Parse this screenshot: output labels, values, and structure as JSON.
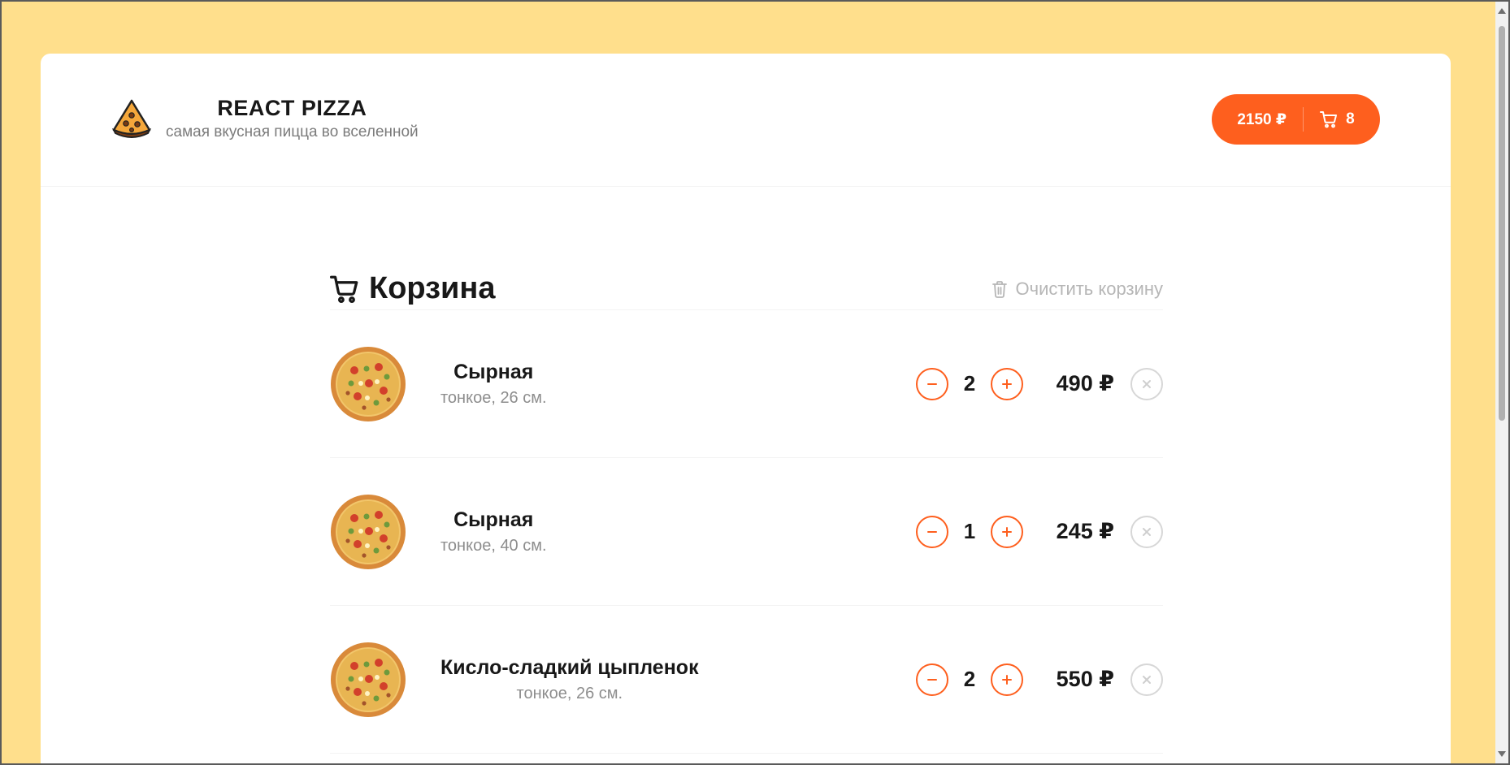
{
  "header": {
    "title": "REACT PIZZA",
    "subtitle": "самая вкусная пицца во вселенной",
    "logo_icon": "pizza-slice-icon"
  },
  "cart_button": {
    "total": "2150 ₽",
    "count": "8",
    "icon": "cart-icon"
  },
  "cart": {
    "title": "Корзина",
    "clear_label": "Очистить корзину",
    "items": [
      {
        "name": "Сырная",
        "desc": "тонкое, 26 см.",
        "qty": "2",
        "price": "490 ₽"
      },
      {
        "name": "Сырная",
        "desc": "тонкое, 40 см.",
        "qty": "1",
        "price": "245 ₽"
      },
      {
        "name": "Кисло-сладкий цыпленок",
        "desc": "тонкое, 26 см.",
        "qty": "2",
        "price": "550 ₽"
      }
    ]
  },
  "colors": {
    "page_bg": "#ffdf8c",
    "accent": "#fe5f1e",
    "muted": "#b6b6b6"
  }
}
